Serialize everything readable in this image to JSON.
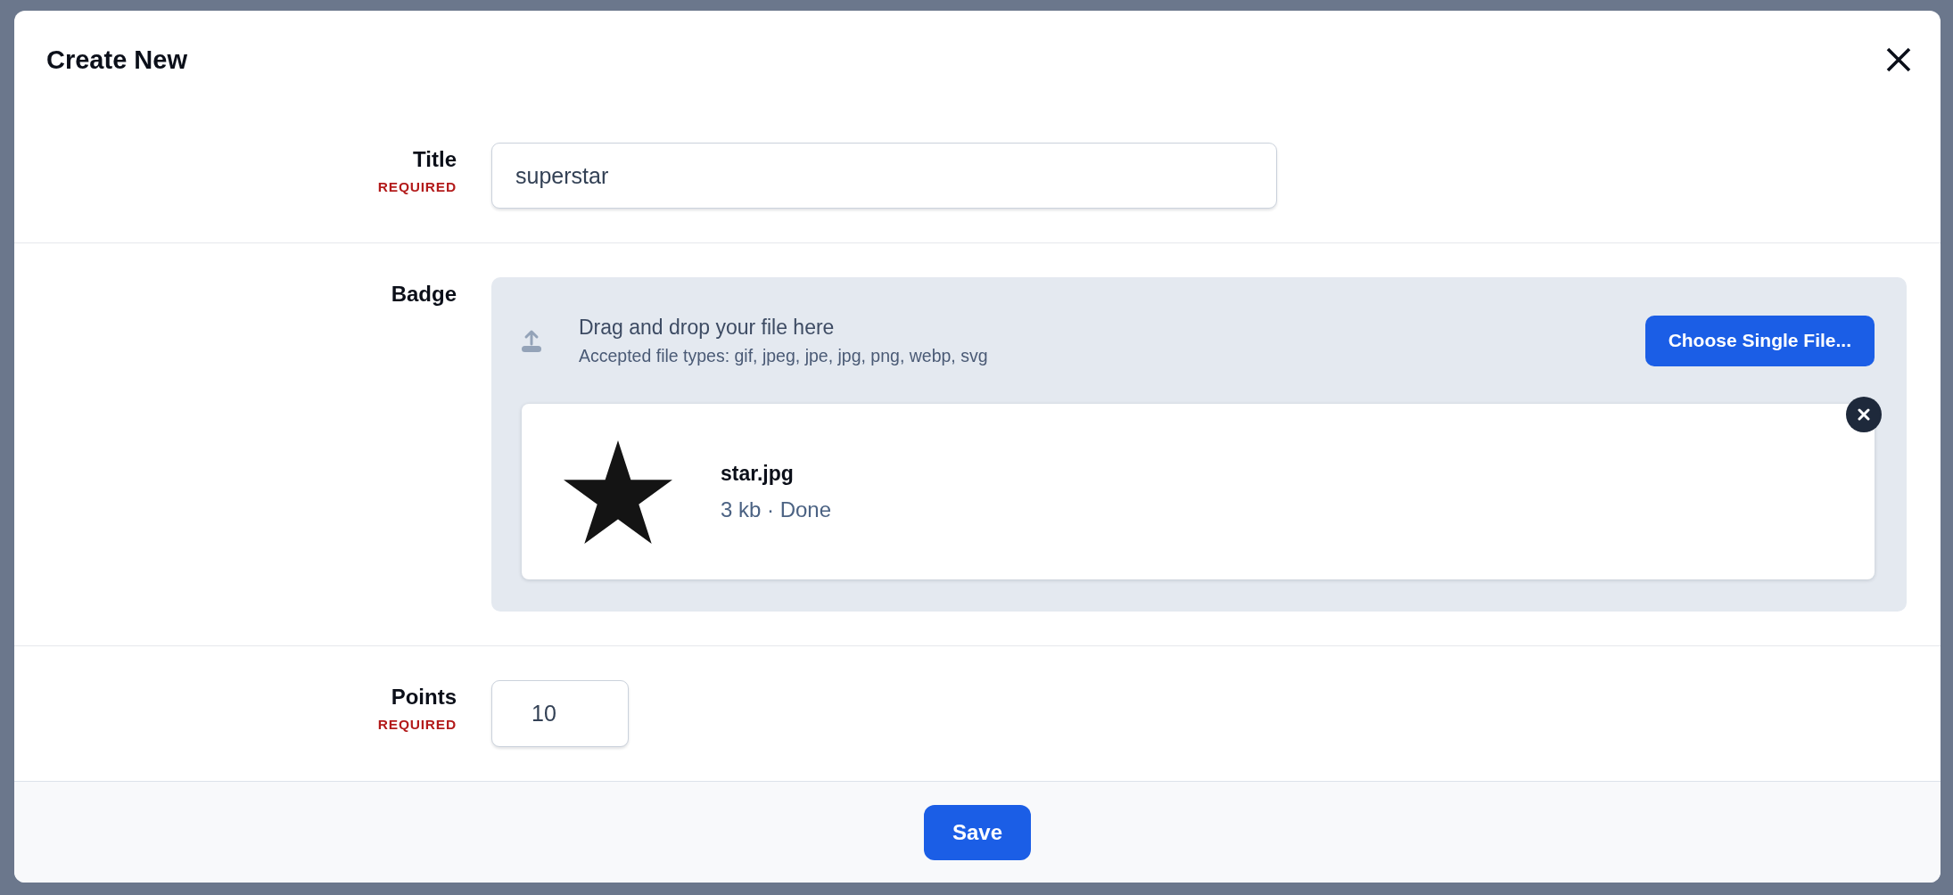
{
  "dialog": {
    "title": "Create New"
  },
  "fields": [
    {
      "kind": "text",
      "label": "Title",
      "required_note": "REQUIRED",
      "value": "superstar"
    },
    {
      "kind": "upload",
      "label": "Badge",
      "dropzone": {
        "prompt": "Drag and drop your file here",
        "hint": "Accepted file types: gif, jpeg, jpe, jpg, png, webp, svg",
        "button": "Choose Single File..."
      },
      "files": [
        {
          "name": "star.jpg",
          "meta": "3 kb · Done"
        }
      ]
    },
    {
      "kind": "number",
      "label": "Points",
      "required_note": "REQUIRED",
      "value": "10"
    }
  ],
  "footer": {
    "button": "Save"
  }
}
